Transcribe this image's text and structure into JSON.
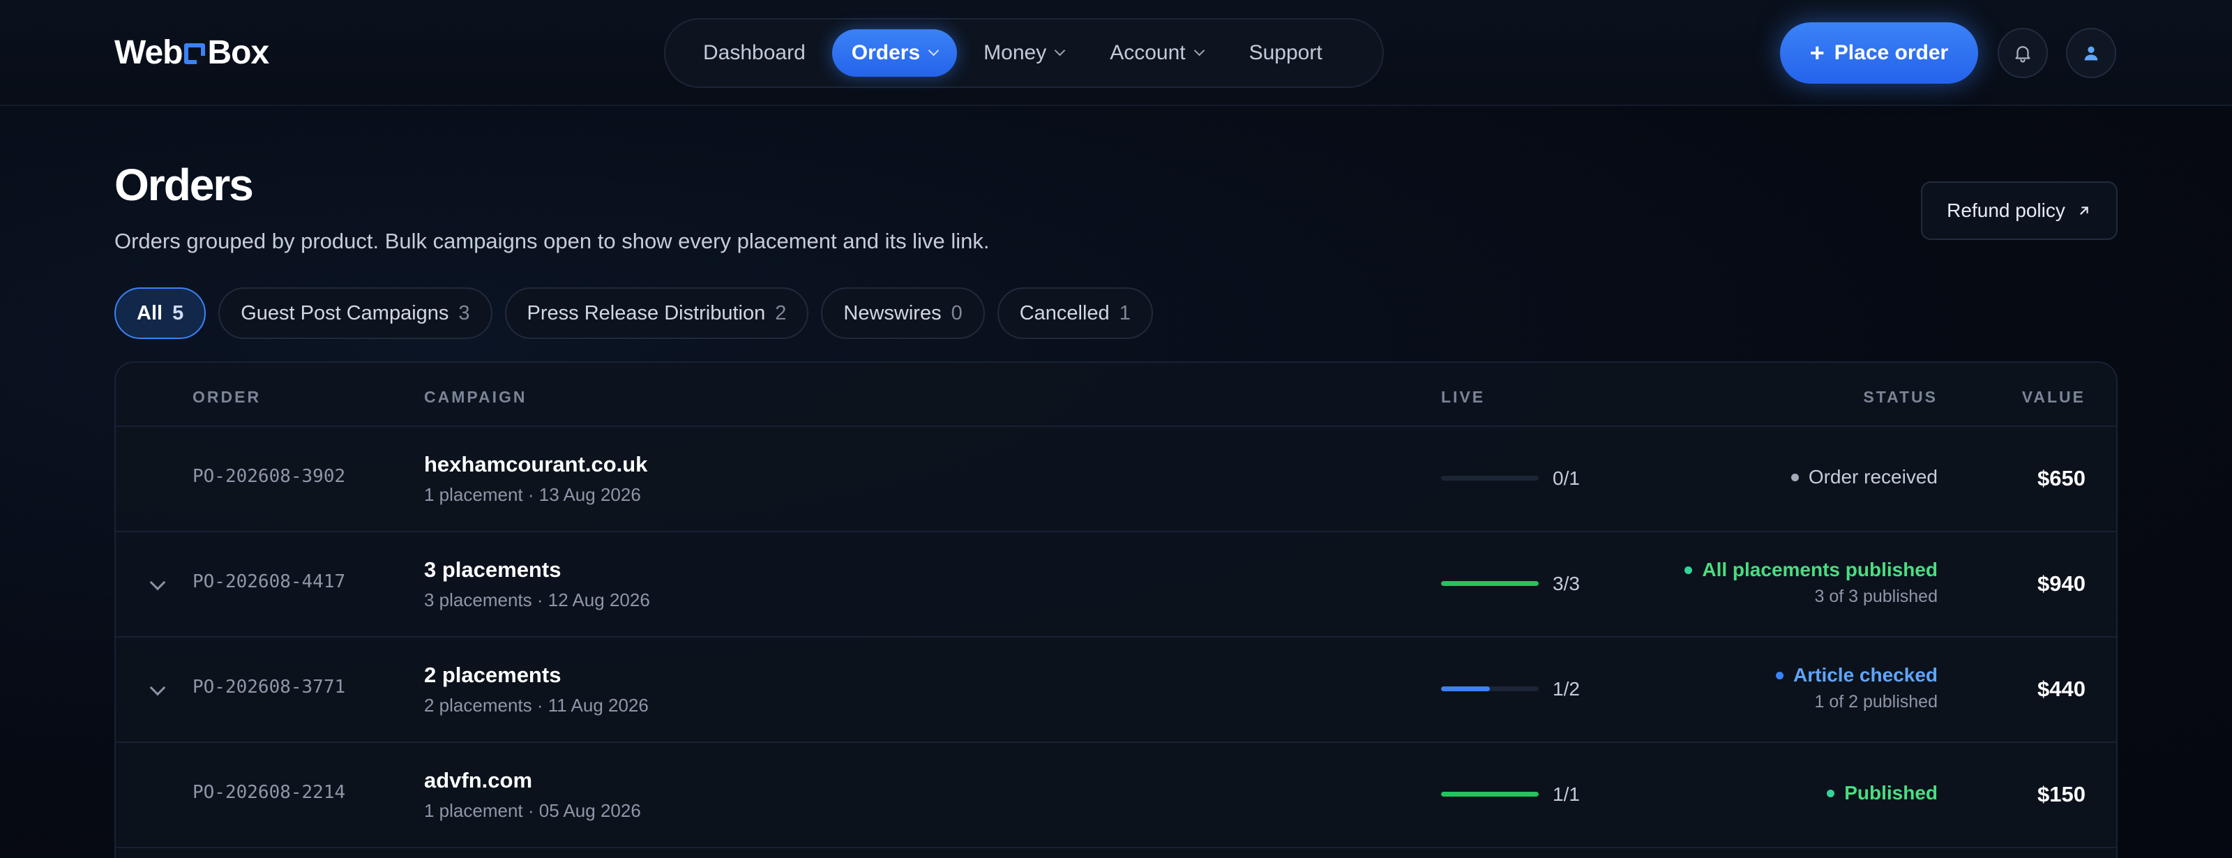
{
  "brand": {
    "name_left": "Web",
    "name_right": "Box"
  },
  "nav": {
    "items": [
      {
        "label": "Dashboard",
        "active": false,
        "dropdown": false
      },
      {
        "label": "Orders",
        "active": true,
        "dropdown": true
      },
      {
        "label": "Money",
        "active": false,
        "dropdown": true
      },
      {
        "label": "Account",
        "active": false,
        "dropdown": true
      },
      {
        "label": "Support",
        "active": false,
        "dropdown": false
      }
    ]
  },
  "header": {
    "place_order_label": "Place order",
    "icons": [
      "plus-icon",
      "bell-icon",
      "user-icon"
    ]
  },
  "page": {
    "title": "Orders",
    "subtitle": "Orders grouped by product. Bulk campaigns open to show every placement and its live link.",
    "refund_label": "Refund policy"
  },
  "filters": [
    {
      "label": "All",
      "count": "5",
      "active": true
    },
    {
      "label": "Guest Post Campaigns",
      "count": "3",
      "active": false
    },
    {
      "label": "Press Release Distribution",
      "count": "2",
      "active": false
    },
    {
      "label": "Newswires",
      "count": "0",
      "active": false
    },
    {
      "label": "Cancelled",
      "count": "1",
      "active": false
    }
  ],
  "table": {
    "columns": {
      "order": "ORDER",
      "campaign": "CAMPAIGN",
      "live": "LIVE",
      "status": "STATUS",
      "value": "VALUE"
    },
    "rows": [
      {
        "order_id": "PO-202608-3902",
        "title": "hexhamcourant.co.uk",
        "sub": "1 placement · 13 Aug 2026",
        "live_text": "0/1",
        "live_fraction": 0,
        "status": "Order received",
        "status_sub": "",
        "status_color": "#a3aab8",
        "status_text_color": "#c6cdda",
        "value": "$650",
        "expandable": false
      },
      {
        "order_id": "PO-202608-4417",
        "title": "3 placements",
        "sub": "3 placements · 12 Aug 2026",
        "live_text": "3/3",
        "live_fraction": 1,
        "status": "All placements published",
        "status_sub": "3 of 3 published",
        "status_color": "#34d399",
        "status_text_color": "#4ade80",
        "value": "$940",
        "expandable": true
      },
      {
        "order_id": "PO-202608-3771",
        "title": "2 placements",
        "sub": "2 placements · 11 Aug 2026",
        "live_text": "1/2",
        "live_fraction": 0.5,
        "status": "Article checked",
        "status_sub": "1 of 2 published",
        "status_color": "#3b82f6",
        "status_text_color": "#60a5fa",
        "value": "$440",
        "expandable": true
      },
      {
        "order_id": "PO-202608-2214",
        "title": "advfn.com",
        "sub": "1 placement · 05 Aug 2026",
        "live_text": "1/1",
        "live_fraction": 1,
        "status": "Published",
        "status_sub": "",
        "status_color": "#34d399",
        "status_text_color": "#4ade80",
        "value": "$150",
        "expandable": false
      }
    ]
  },
  "colors": {
    "accent": "#3b82f6",
    "success": "#22c55e",
    "background": "#060a13"
  }
}
